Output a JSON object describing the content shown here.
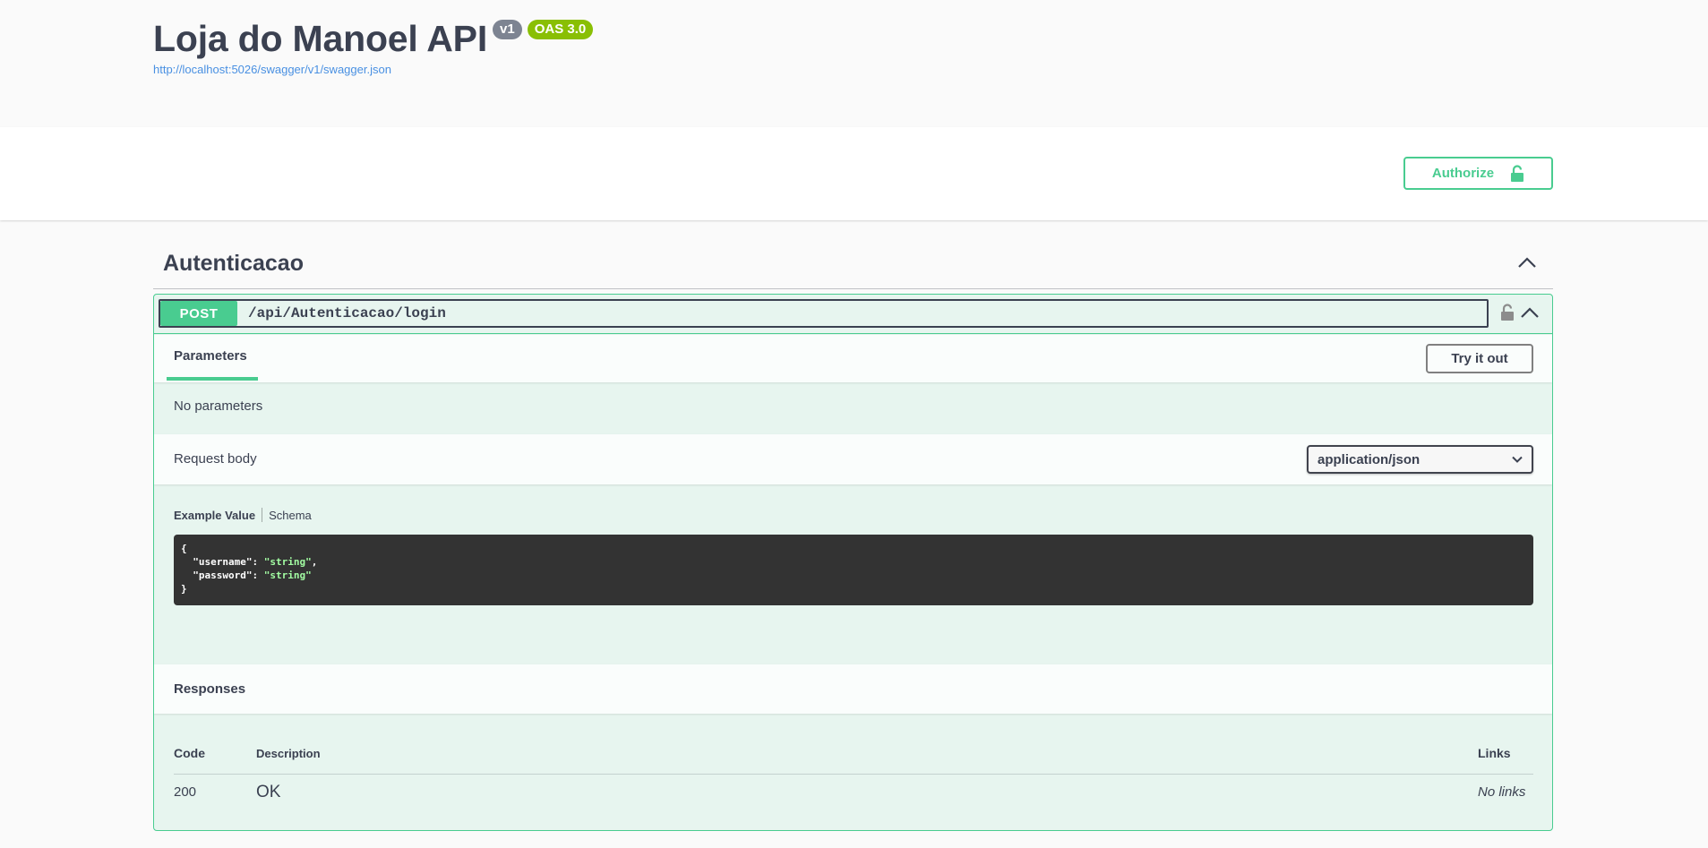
{
  "info": {
    "title": "Loja do Manoel API",
    "version_badge": "v1",
    "oas_badge": "OAS 3.0",
    "spec_url": "http://localhost:5026/swagger/v1/swagger.json"
  },
  "scheme": {
    "authorize_label": "Authorize"
  },
  "tag": {
    "name": "Autenticacao"
  },
  "operation": {
    "method": "POST",
    "path": "/api/Autenticacao/login",
    "parameters_tab": "Parameters",
    "try_it_out_label": "Try it out",
    "no_parameters": "No parameters",
    "request_body_label": "Request body",
    "content_type": "application/json",
    "example_value_tab": "Example Value",
    "schema_tab": "Schema",
    "example": {
      "open": "{",
      "username_key": "  \"username\"",
      "username_val": "\"string\"",
      "password_key": "  \"password\"",
      "password_val": "\"string\"",
      "close": "}"
    },
    "responses_label": "Responses",
    "responses_table": {
      "headers": {
        "code": "Code",
        "description": "Description",
        "links": "Links"
      },
      "rows": [
        {
          "code": "200",
          "description": "OK",
          "links": "No links"
        }
      ]
    }
  },
  "colors": {
    "post_green": "#49cc90",
    "badge_grey": "#7d8492",
    "oas_green": "#89bf04",
    "link_blue": "#4990e2",
    "code_bg": "#333333",
    "code_string": "#a2fca2"
  }
}
